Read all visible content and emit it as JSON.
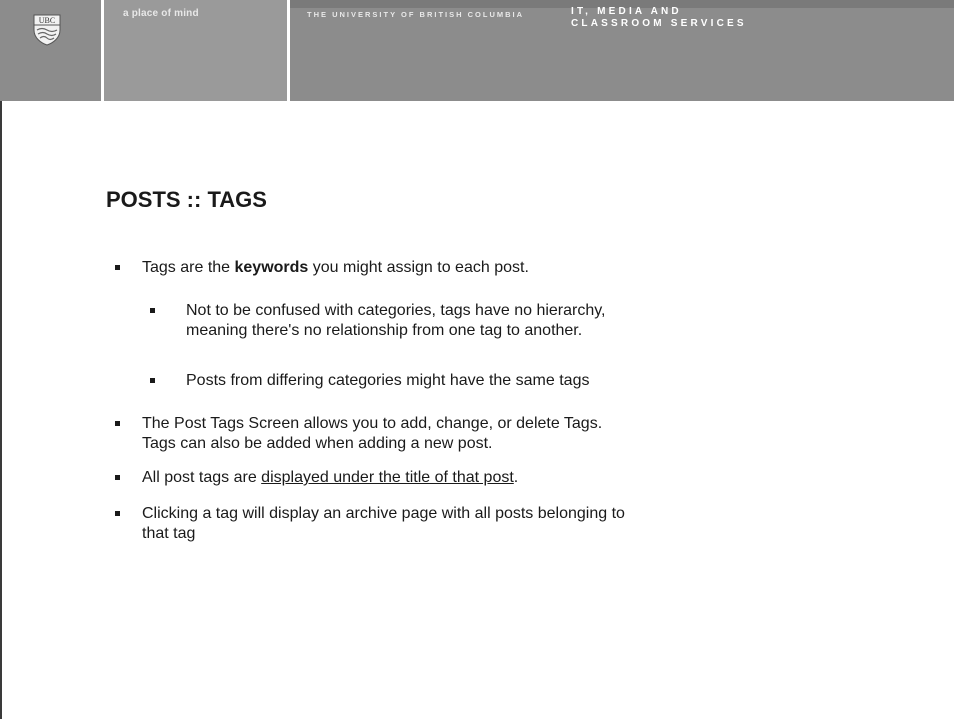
{
  "header": {
    "logo_text": "UBC",
    "tagline": "a place of mind",
    "university": "THE UNIVERSITY OF BRITISH COLUMBIA",
    "dept_line1": "IT, MEDIA AND",
    "dept_line2": "CLASSROOM SERVICES"
  },
  "slide": {
    "title": "POSTS :: TAGS",
    "b1_pre": "Tags are the ",
    "b1_bold": "keywords",
    "b1_post": " you might assign to each post.",
    "b1a_line1": "Not to be confused with categories, tags have no hierarchy,",
    "b1a_line2": "meaning there's no relationship from one tag to another.",
    "b1b": "Posts from differing categories might have the same tags",
    "b2_line1": "The Post Tags Screen allows you to add, change, or delete Tags.",
    "b2_line2": "Tags can also be added when adding a new post.",
    "b3_pre": "All post tags are ",
    "b3_link": "displayed under the title of that post",
    "b3_post": ".",
    "b4_line1": "Clicking a tag will display an archive page with all posts belonging to",
    "b4_line2": "that tag"
  }
}
